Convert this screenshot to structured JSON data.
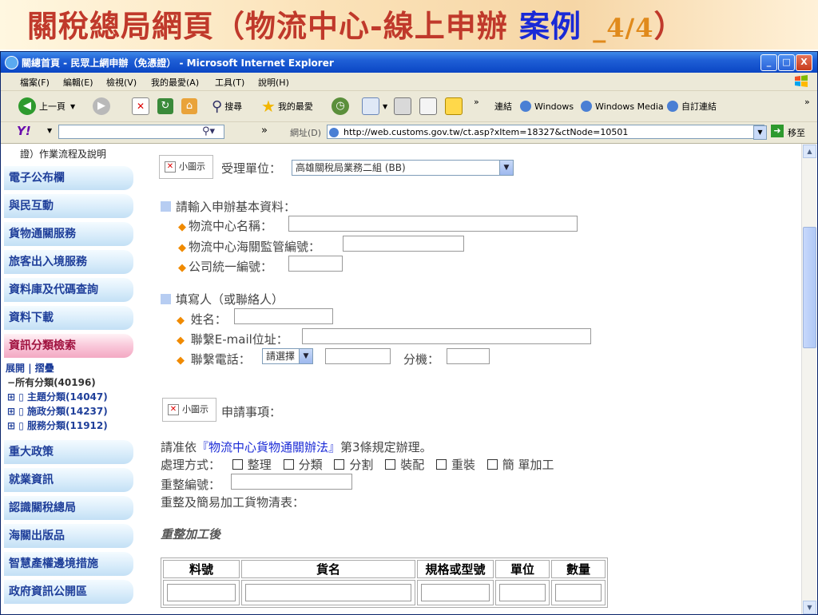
{
  "slide": {
    "title_main": "關稅總局網頁（物流中心-線上申辦",
    "title_case": "案例",
    "title_page": "_4/4",
    "title_close": "）"
  },
  "window": {
    "title": "關總首頁 - 民眾上網申辦（免憑證） - Microsoft Internet Explorer",
    "min": "_",
    "max": "□",
    "close": "X"
  },
  "menu": [
    "檔案(F)",
    "編輯(E)",
    "檢視(V)",
    "我的最愛(A)",
    "工具(T)",
    "說明(H)"
  ],
  "toolbar": {
    "back": "上一頁",
    "search": "搜尋",
    "favorites": "我的最愛",
    "links_label": "連結",
    "link1": "Windows",
    "link2": "Windows Media",
    "link3": "自訂連結"
  },
  "addressbar": {
    "label": "網址(D)",
    "url": "http://web.customs.gov.tw/ct.asp?xItem=18327&ctNode=10501",
    "go": "移至",
    "yahoo": "Y!"
  },
  "sidebar": {
    "top_text": "證）作業流程及說明",
    "items_top": [
      "電子公布欄",
      "與民互動",
      "貨物通關服務",
      "旅客出入境服務",
      "資料庫及代碼查詢",
      "資料下載",
      "資訊分類檢索"
    ],
    "expand": "展開",
    "collapse": "摺疊",
    "tree_root": "所有分類(40196)",
    "tree": [
      "主題分類(14047)",
      "施政分類(14237)",
      "服務分類(11912)"
    ],
    "items_bottom": [
      "重大政策",
      "就業資訊",
      "認識關稅總局",
      "海關出版品",
      "智慧產權邊境措施",
      "政府資訊公開區"
    ]
  },
  "form": {
    "img_alt": "小圖示",
    "unit_label": "受理單位：",
    "unit_value": "高雄關稅局業務二組 (BB)",
    "basic_heading": "請輸入申辦基本資料：",
    "center_name": "物流中心名稱：",
    "customs_no": "物流中心海關監管編號：",
    "company_no": "公司統一編號：",
    "filler_heading": "填寫人（或聯絡人）",
    "name": "姓名：",
    "email": "聯繫E-mail位址：",
    "phone": "聯繫電話：",
    "phone_select": "請選擇",
    "ext": "分機：",
    "apply_label": "申請事項：",
    "rule_pre": "請准依",
    "rule_link": "『物流中心貨物通關辦法』",
    "rule_post": "第3條規定辦理。",
    "method_label": "處理方式：",
    "methods": [
      "整理",
      "分類",
      "分割",
      "裝配",
      "重裝",
      "簡 單加工"
    ],
    "reno_label": "重整編號：",
    "list_label": "重整及簡易加工貨物清表：",
    "after_label": "重整加工後"
  },
  "table": {
    "headers": [
      "料號",
      "貨名",
      "規格或型號",
      "單位",
      "數量"
    ]
  },
  "colors": {
    "title_red": "#c0392b",
    "title_blue": "#1a2ad6",
    "sidebar_text": "#1f3f9a",
    "highlight_pink": "#f3a9c3"
  }
}
